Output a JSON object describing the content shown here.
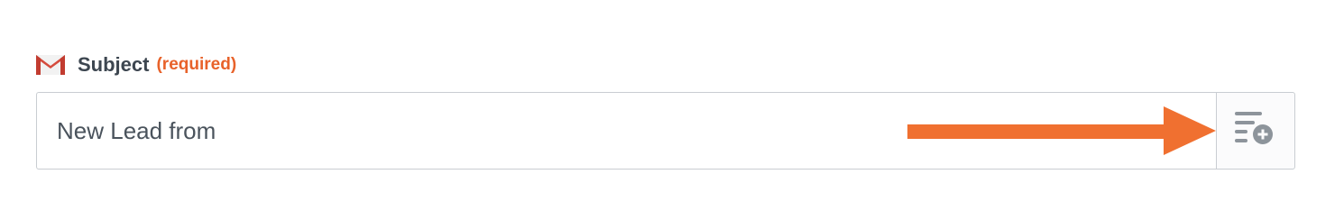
{
  "subject_field": {
    "icon": "gmail-icon",
    "label": "Subject",
    "required_label": "(required)",
    "value": "New Lead from",
    "insert_button_icon": "insert-data-icon"
  },
  "annotation": {
    "icon": "arrow-right-icon",
    "color": "#f07030"
  },
  "colors": {
    "required": "#e8622a",
    "label": "#3d4650",
    "border": "#c9cdd2"
  }
}
